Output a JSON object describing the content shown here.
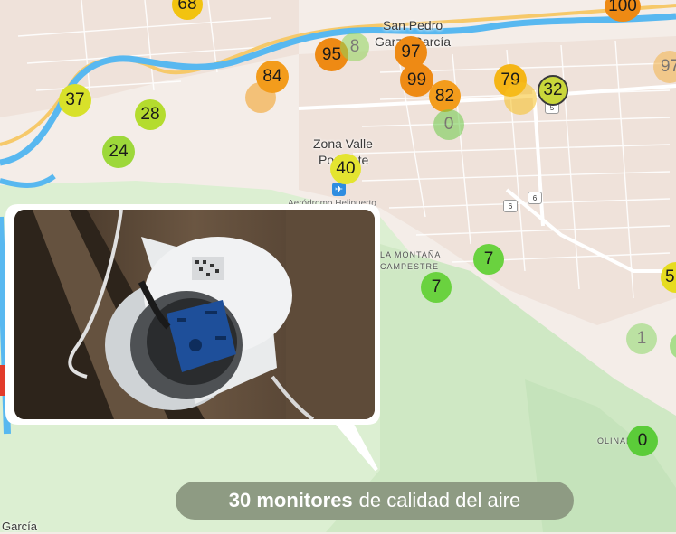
{
  "map": {
    "places": [
      {
        "id": "san-pedro",
        "text": "San Pedro"
      },
      {
        "id": "garza-garcia",
        "text": "Garza García"
      },
      {
        "id": "zona-valle",
        "text": "Zona Valle"
      },
      {
        "id": "poniente",
        "text": "Poniente"
      },
      {
        "id": "aerodromo",
        "text": "Aeródromo Helipuerto"
      },
      {
        "id": "la-montana",
        "text": "LA MONTAÑA"
      },
      {
        "id": "campestre",
        "text": "CAMPESTRE"
      },
      {
        "id": "olinala",
        "text": "OLINALÁ"
      },
      {
        "id": "bottom-garcia",
        "text": "García"
      }
    ],
    "road_shields": [
      "5",
      "6",
      "6"
    ],
    "airport_icon": "airplane-icon",
    "markers": [
      {
        "value": "68",
        "color": "#f2c310"
      },
      {
        "value": "100",
        "color": "#ee8a14"
      },
      {
        "value": "97",
        "color": "#f0a830"
      },
      {
        "value": "95",
        "color": "#ee8a14"
      },
      {
        "value": "8",
        "color": "#8fd45a"
      },
      {
        "value": "97",
        "color": "#ee8a14"
      },
      {
        "value": "84",
        "color": "#f39c1c"
      },
      {
        "value": "",
        "color": "#f39c1c"
      },
      {
        "value": "99",
        "color": "#ee8a14"
      },
      {
        "value": "82",
        "color": "#f39c1c"
      },
      {
        "value": "79",
        "color": "#f5b516"
      },
      {
        "value": "",
        "color": "#f5c020"
      },
      {
        "value": "32",
        "color": "#c9d63a"
      },
      {
        "value": "0",
        "color": "#6dcc4a"
      },
      {
        "value": "37",
        "color": "#d8e12a"
      },
      {
        "value": "28",
        "color": "#b4dc2e"
      },
      {
        "value": "24",
        "color": "#9dd83a"
      },
      {
        "value": "40",
        "color": "#e4e430"
      },
      {
        "value": "7",
        "color": "#6ad23f"
      },
      {
        "value": "7",
        "color": "#6ad23f"
      },
      {
        "value": "5",
        "color": "#e6dc20"
      },
      {
        "value": "1",
        "color": "#8ed86a"
      },
      {
        "value": "",
        "color": "#6ad23f"
      },
      {
        "value": "0",
        "color": "#5bcc39"
      },
      {
        "value": "",
        "color": "#e23b2a"
      },
      {
        "value": "97",
        "color": "#f3b34a"
      }
    ]
  },
  "caption": {
    "bold": "30 monitores",
    "rest": "de calidad del aire",
    "bg_color": "#8e9b83"
  }
}
